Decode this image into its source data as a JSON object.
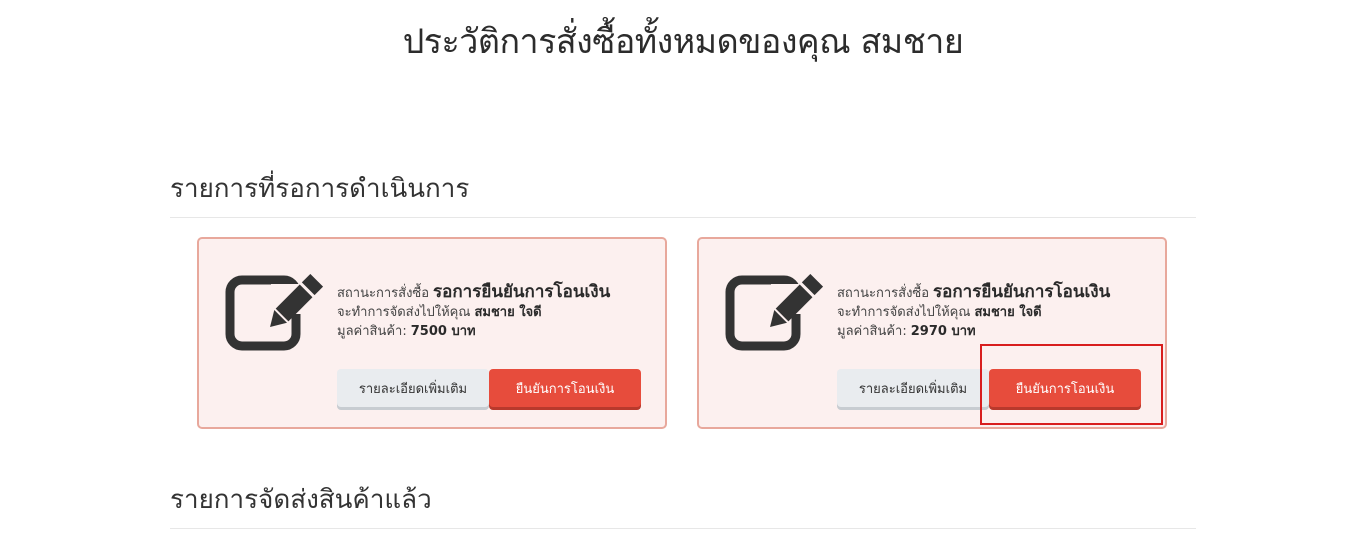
{
  "page": {
    "title": "ประวัติการสั่งซื้อทั้งหมดของคุณ สมชาย"
  },
  "sections": {
    "pending": {
      "title": "รายการที่รอการดำเนินการ"
    },
    "shipped": {
      "title": "รายการจัดส่งสินค้าแล้ว"
    }
  },
  "orders": [
    {
      "status_label": "สถานะการสั่งซื้อ",
      "status_value": "รอการยืนยันการโอนเงิน",
      "shipping_label": "จะทำการจัดส่งไปให้คุณ",
      "recipient": "สมชาย ใจดี",
      "price_label": "มูลค่าสินค้า:",
      "price_value": "7500 บาท",
      "details_button": "รายละเอียดเพิ่มเติม",
      "confirm_button": "ยืนยันการโอนเงิน",
      "icon": "edit-icon"
    },
    {
      "status_label": "สถานะการสั่งซื้อ",
      "status_value": "รอการยืนยันการโอนเงิน",
      "shipping_label": "จะทำการจัดส่งไปให้คุณ",
      "recipient": "สมชาย ใจดี",
      "price_label": "มูลค่าสินค้า:",
      "price_value": "2970 บาท",
      "details_button": "รายละเอียดเพิ่มเติม",
      "confirm_button": "ยืนยันการโอนเงิน",
      "icon": "edit-icon"
    }
  ],
  "colors": {
    "card_background": "#fcf0ef",
    "card_border": "#e8a89c",
    "confirm_button": "#e74c3c",
    "details_button": "#e9ecef",
    "highlight": "#d81e1e"
  }
}
